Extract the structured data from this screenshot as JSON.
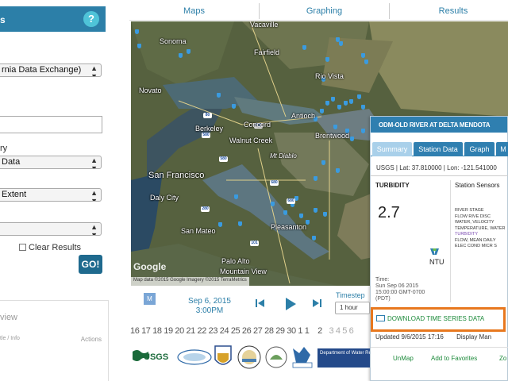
{
  "left_panel": {
    "header_title": "s",
    "help_label": "?",
    "source_select": "rnia Data Exchange)",
    "category_label": "ry",
    "category_select": "Data",
    "extent_select": "Extent",
    "clear_results_label": "Clear Results",
    "go_label": "GO!",
    "results_title": "view",
    "results_col_title": "tle / Info",
    "results_col_actions": "Actions"
  },
  "nav": {
    "maps": "Maps",
    "graphing": "Graphing",
    "results": "Results"
  },
  "map": {
    "labels": [
      "Sonoma",
      "Vacaville",
      "Fairfield",
      "Rio Vista",
      "Novato",
      "Concord",
      "Antioch",
      "Brentwood",
      "Walnut Creek",
      "Berkeley",
      "Mt Diablo",
      "San Francisco",
      "Daly City",
      "San Mateo",
      "Pleasanton",
      "Palo Alto",
      "Mountain View"
    ],
    "highway_shields": [
      "80",
      "680",
      "680",
      "680",
      "580",
      "580",
      "280",
      "101"
    ],
    "google_label": "Google",
    "attribution": "Map data ©2015 Google Imagery ©2015 TerraMetrics"
  },
  "popup": {
    "title": "ODM-OLD RIVER AT DELTA MENDOTA",
    "tabs": [
      "Summary",
      "Station Data",
      "Graph",
      "M"
    ],
    "latlon": "USGS | Lat: 37.810000 | Lon: -121.541000",
    "parameter": "TURBIDITY",
    "value": "2.7",
    "unit": "NTU",
    "time_label": "Time:",
    "time_value_1": "Sun Sep 06 2015",
    "time_value_2": "15:00:00 GMT-0700",
    "time_value_3": "(PDT)",
    "sensors_title": "Station Sensors",
    "sensors": [
      "RIVER STAGE",
      "FLOW RIVE DISC",
      "WATER, VELOCITY",
      "TEMPERATURE, WATER",
      "TURBIDITY",
      "FLOW, MEAN DAILY",
      "ELEC COND MICR S"
    ],
    "download_label": "DOWNLOAD TIME SERIES DATA",
    "updated": "Updated 9/6/2015 17:16",
    "display_label": "Display Man",
    "unmap_label": "UnMap",
    "favorites_label": "Add to Favorites",
    "zoom_label": "Zo"
  },
  "timeline": {
    "m_label": "M",
    "date_line1": "Sep 6, 2015",
    "date_line2": "3:00PM",
    "timestep_label": "Timestep",
    "timestep_value": "1 hour",
    "days_active": "16 17 18 19 20 21 22 23 24 25 26 27 28 29 30 1 1",
    "days_current": "2",
    "days_dim": "3 4 5 6"
  },
  "logos": [
    "USGS",
    "DWR",
    "CALIFORNIA",
    "SWRCB",
    "DFW",
    "SWAMP",
    "Department of Water Resources CALIFORNIA DATA"
  ],
  "colors": {
    "accent": "#2c7fa8",
    "header": "#2f7fb0",
    "download_border": "#e8781e",
    "download_text": "#1c8a3a",
    "pin": "#3a9be0"
  }
}
